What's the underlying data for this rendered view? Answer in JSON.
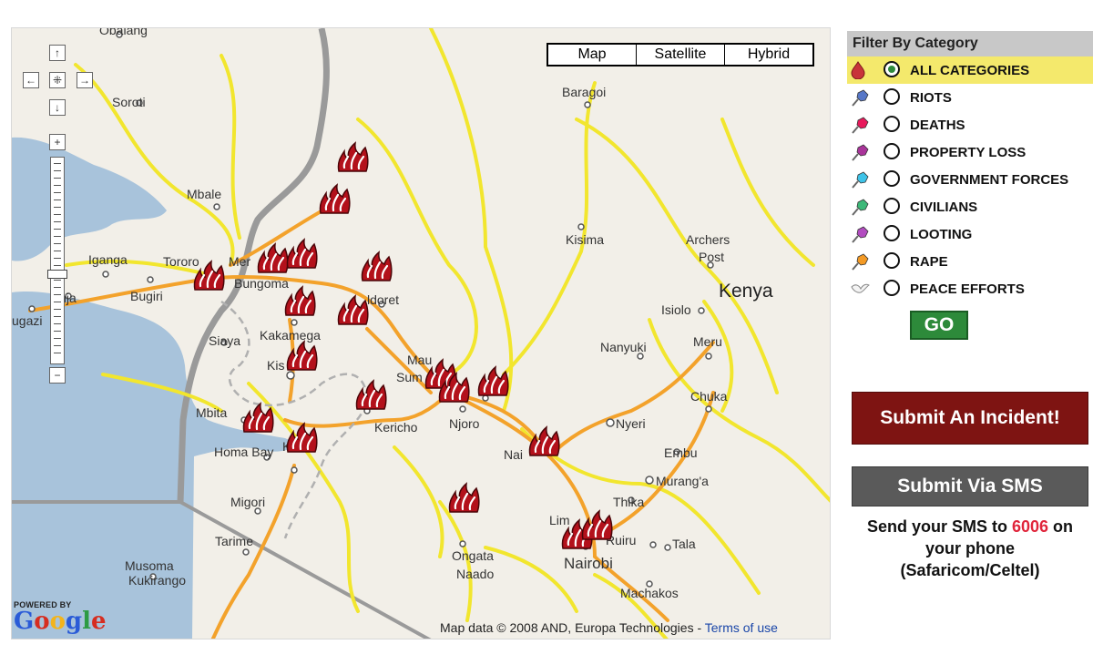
{
  "map": {
    "type_buttons": [
      "Map",
      "Satellite",
      "Hybrid"
    ],
    "nav_controls": {
      "up": "↑",
      "left": "←",
      "center": "⁜",
      "right": "→",
      "down": "↓",
      "zoom_in": "+",
      "zoom_out": "−"
    },
    "places": [
      "Obalang",
      "Soroti",
      "Mbale",
      "Iganga",
      "Tororo",
      "Mer",
      "Bungoma",
      "Jinja",
      "Bugiri",
      "ugazi",
      "Siaya",
      "Kakamega",
      "Kis",
      "Mbita",
      "Homa Bay",
      "Kisii",
      "Migori",
      "Tarime",
      "Musoma",
      "Kukirango",
      "Baragoi",
      "Kisima",
      "Archers",
      "Post",
      "Isiolo",
      "Nanyuki",
      "Meru",
      "Chuka",
      "Nyeri",
      "Embu",
      "Murang'a",
      "Thika",
      "Ruiru",
      "Tala",
      "Lim",
      "Nairobi",
      "Machakos",
      "Ongata",
      "Naado",
      "Nai",
      "Njoro",
      "Kericho",
      "Sum",
      "Mau",
      "ldoret"
    ],
    "country_label": "Kenya",
    "incident_icon": "fire-incident-icon",
    "attribution": "Map data © 2008 AND, Europa Technologies - ",
    "terms_link": "Terms of use",
    "powered_by": "POWERED BY",
    "google_letters": [
      "G",
      "o",
      "o",
      "g",
      "l",
      "e"
    ],
    "google_colors": [
      "#2a5bd7",
      "#d62d20",
      "#f3b41b",
      "#2a5bd7",
      "#2d9b43",
      "#d62d20"
    ],
    "colors": {
      "water": "#a8c3db",
      "land": "#f2efe8",
      "major_road": "#f3a22b",
      "road": "#f2e62e",
      "border": "#9a9a9a"
    }
  },
  "filter": {
    "title": "Filter By Category",
    "categories": [
      {
        "label": "ALL CATEGORIES",
        "color": "#c8343a",
        "icon": "drop-icon",
        "selected": true
      },
      {
        "label": "RIOTS",
        "color": "#5777c7",
        "icon": "pushpin-icon",
        "selected": false
      },
      {
        "label": "DEATHS",
        "color": "#e8195c",
        "icon": "pushpin-icon",
        "selected": false
      },
      {
        "label": "PROPERTY LOSS",
        "color": "#a9349a",
        "icon": "pushpin-icon",
        "selected": false
      },
      {
        "label": "GOVERNMENT FORCES",
        "color": "#3ec3e8",
        "icon": "pushpin-icon",
        "selected": false
      },
      {
        "label": "CIVILIANS",
        "color": "#3cb878",
        "icon": "pushpin-icon",
        "selected": false
      },
      {
        "label": "LOOTING",
        "color": "#b24cc0",
        "icon": "pushpin-icon",
        "selected": false
      },
      {
        "label": "RAPE",
        "color": "#f39a25",
        "icon": "pushpin-icon",
        "selected": false
      },
      {
        "label": "PEACE EFFORTS",
        "color": "#c8c8c8",
        "icon": "dove-icon",
        "selected": false
      }
    ],
    "go_label": "GO"
  },
  "submit_incident_label": "Submit An Incident!",
  "submit_sms_label": "Submit Via SMS",
  "sms_info": {
    "prefix": "Send your SMS to ",
    "number": "6006",
    "suffix": " on your phone",
    "networks": "(Safaricom/Celtel)"
  }
}
